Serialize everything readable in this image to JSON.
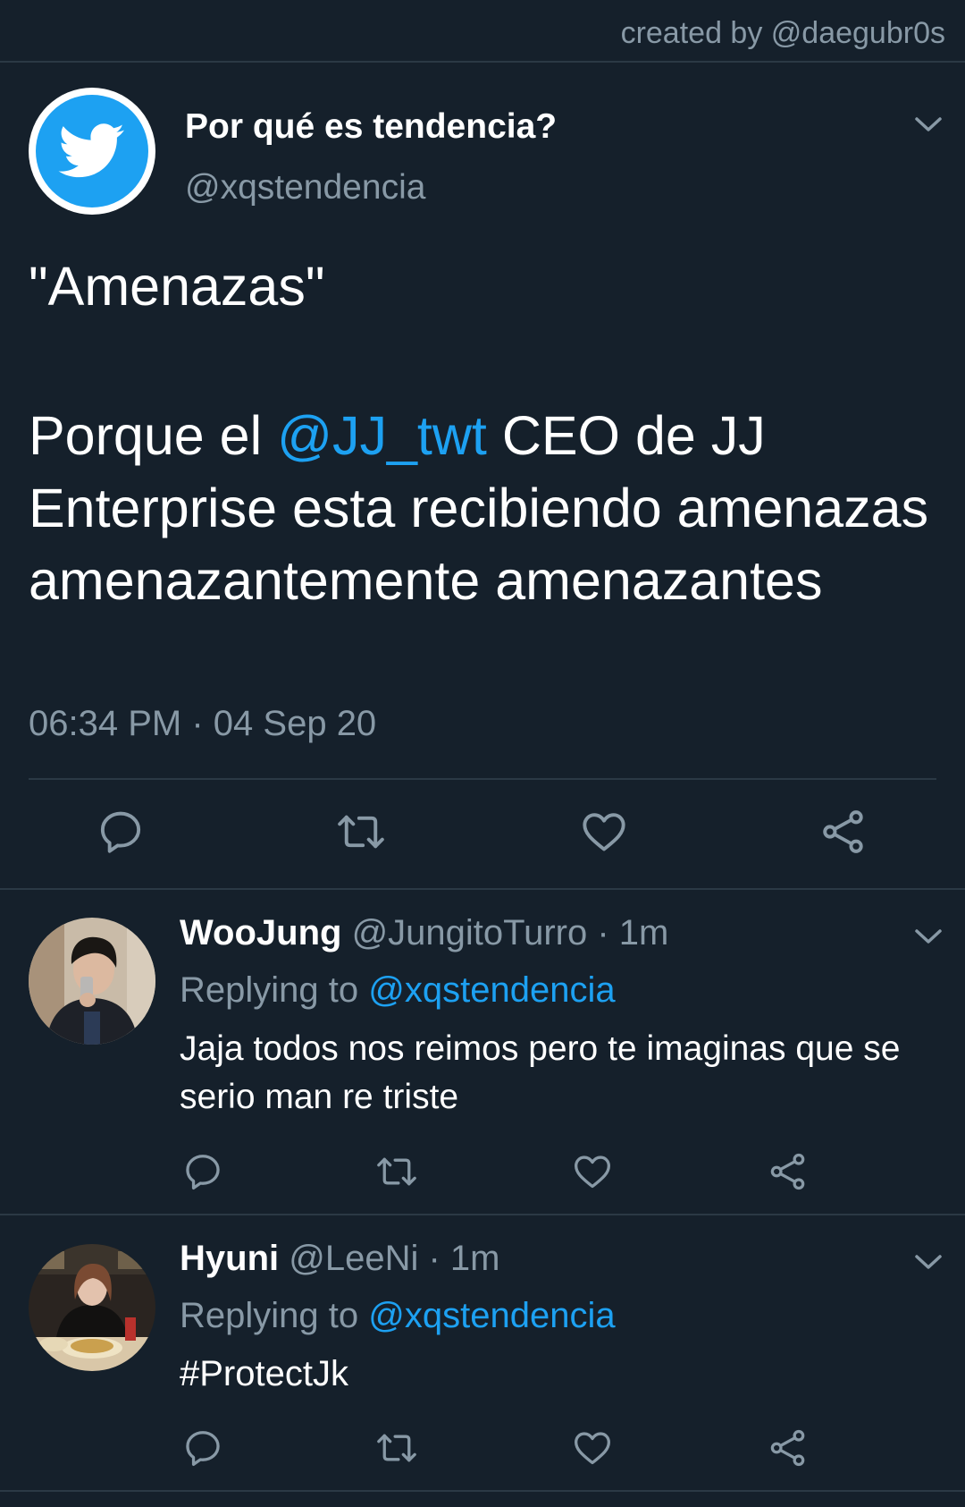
{
  "watermark": "created by @daegubr0s",
  "colors": {
    "background": "#15202b",
    "accent": "#1da1f2",
    "secondary_text": "#8899a6",
    "divider": "#2b3945"
  },
  "main_tweet": {
    "avatar_icon": "twitter-bird-icon",
    "name": "Por qué es tendencia?",
    "handle": "@xqstendencia",
    "quote": "\"Amenazas\"",
    "body_before": "Porque el ",
    "mention": "@JJ_twt",
    "body_after": " CEO de JJ Enterprise esta recibiendo amenazas amenazantemente amenazantes",
    "time": "06:34 PM",
    "separator": "·",
    "date": "04 Sep 20",
    "actions": [
      "reply-icon",
      "retweet-icon",
      "like-icon",
      "share-icon"
    ]
  },
  "replies": [
    {
      "name": "WooJung",
      "handle": "@JungitoTurro",
      "age": "· 1m",
      "replying_label": "Replying to",
      "replying_to": "@xqstendencia",
      "text": "Jaja todos nos reimos pero te imaginas que se serio man re triste"
    },
    {
      "name": "Hyuni",
      "handle": "@LeeNi",
      "age": "· 1m",
      "replying_label": "Replying to",
      "replying_to": "@xqstendencia",
      "text": "#ProtectJk"
    }
  ]
}
